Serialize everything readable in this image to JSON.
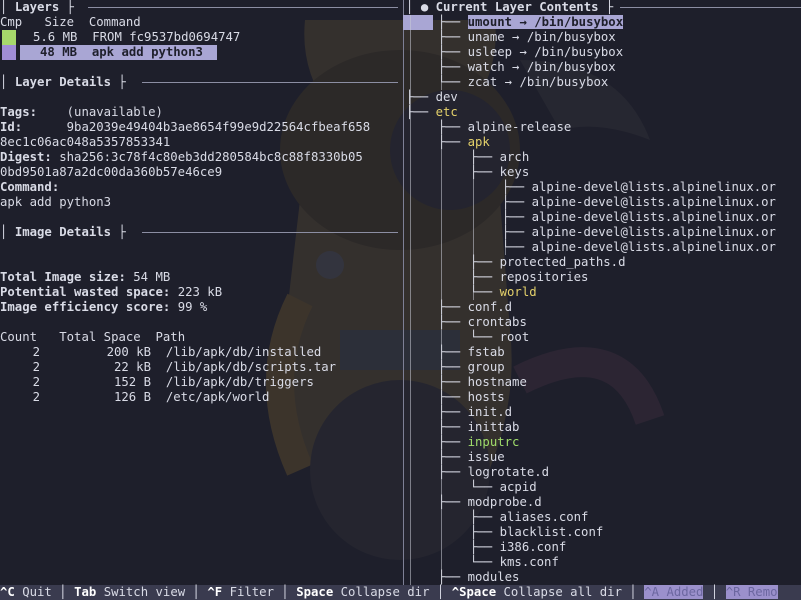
{
  "panes": {
    "layers": {
      "title": "Layers",
      "columns": [
        "Cmp",
        "Size",
        "Command"
      ],
      "rows": [
        {
          "size": "5.6 MB",
          "command": "FROM fc9537bd0694747",
          "swatch": "#a6d86b",
          "selected": false
        },
        {
          "size": "48 MB",
          "command": "apk add python3",
          "swatch": "#a08dd6",
          "selected": true
        }
      ]
    },
    "layer_details": {
      "title": "Layer Details",
      "tags_label": "Tags:",
      "tags_value": "(unavailable)",
      "id_label": "Id:",
      "id_value_1": "9ba2039e49404b3ae8654f99e9d22564cfbeaf658",
      "id_value_2": "8ec1c06ac048a5357853341",
      "digest_label": "Digest:",
      "digest_value_1": "sha256:3c78f4c80eb3dd280584bc8c88f8330b05",
      "digest_value_2": "0bd9501a87a2dc00da360b57e46ce9",
      "command_label": "Command:",
      "command_value": "apk add python3"
    },
    "image_details": {
      "title": "Image Details",
      "total_size_label": "Total Image size:",
      "total_size_value": "54 MB",
      "wasted_label": "Potential wasted space:",
      "wasted_value": "223 kB",
      "efficiency_label": "Image efficiency score:",
      "efficiency_value": "99 %",
      "table_headers": [
        "Count",
        "Total Space",
        "Path"
      ],
      "rows": [
        {
          "count": "2",
          "space": "200 kB",
          "path": "/lib/apk/db/installed"
        },
        {
          "count": "2",
          "space": "22 kB",
          "path": "/lib/apk/db/scripts.tar"
        },
        {
          "count": "2",
          "space": "152 B",
          "path": "/lib/apk/db/triggers"
        },
        {
          "count": "2",
          "space": "126 B",
          "path": "/etc/apk/world"
        }
      ]
    },
    "contents": {
      "title": "Current Layer Contents",
      "tree": [
        {
          "prefix": "├── ",
          "text": "umount → /bin/busybox",
          "depth": 1,
          "state": "selected"
        },
        {
          "prefix": "├── ",
          "text": "uname → /bin/busybox",
          "depth": 1,
          "state": "normal"
        },
        {
          "prefix": "├── ",
          "text": "usleep → /bin/busybox",
          "depth": 1,
          "state": "normal"
        },
        {
          "prefix": "├── ",
          "text": "watch → /bin/busybox",
          "depth": 1,
          "state": "normal"
        },
        {
          "prefix": "└── ",
          "text": "zcat → /bin/busybox",
          "depth": 1,
          "state": "normal"
        },
        {
          "prefix": "├── ",
          "text": "dev",
          "depth": 0,
          "state": "normal"
        },
        {
          "prefix": "├── ",
          "text": "etc",
          "depth": 0,
          "state": "modified"
        },
        {
          "prefix": "├── ",
          "text": "alpine-release",
          "depth": 1,
          "state": "normal"
        },
        {
          "prefix": "├── ",
          "text": "apk",
          "depth": 1,
          "state": "modified"
        },
        {
          "prefix": "├── ",
          "text": "arch",
          "depth": 2,
          "state": "normal"
        },
        {
          "prefix": "├── ",
          "text": "keys",
          "depth": 2,
          "state": "normal"
        },
        {
          "prefix": "├── ",
          "text": "alpine-devel@lists.alpinelinux.or",
          "depth": 3,
          "state": "normal"
        },
        {
          "prefix": "├── ",
          "text": "alpine-devel@lists.alpinelinux.or",
          "depth": 3,
          "state": "normal"
        },
        {
          "prefix": "├── ",
          "text": "alpine-devel@lists.alpinelinux.or",
          "depth": 3,
          "state": "normal"
        },
        {
          "prefix": "├── ",
          "text": "alpine-devel@lists.alpinelinux.or",
          "depth": 3,
          "state": "normal"
        },
        {
          "prefix": "└── ",
          "text": "alpine-devel@lists.alpinelinux.or",
          "depth": 3,
          "state": "normal"
        },
        {
          "prefix": "├── ",
          "text": "protected_paths.d",
          "depth": 2,
          "state": "normal"
        },
        {
          "prefix": "├── ",
          "text": "repositories",
          "depth": 2,
          "state": "normal"
        },
        {
          "prefix": "└── ",
          "text": "world",
          "depth": 2,
          "state": "modified"
        },
        {
          "prefix": "├── ",
          "text": "conf.d",
          "depth": 1,
          "state": "normal"
        },
        {
          "prefix": "├── ",
          "text": "crontabs",
          "depth": 1,
          "state": "normal"
        },
        {
          "prefix": "└── ",
          "text": "root",
          "depth": 2,
          "state": "normal"
        },
        {
          "prefix": "├── ",
          "text": "fstab",
          "depth": 1,
          "state": "normal"
        },
        {
          "prefix": "├── ",
          "text": "group",
          "depth": 1,
          "state": "normal"
        },
        {
          "prefix": "├── ",
          "text": "hostname",
          "depth": 1,
          "state": "normal"
        },
        {
          "prefix": "├── ",
          "text": "hosts",
          "depth": 1,
          "state": "normal"
        },
        {
          "prefix": "├── ",
          "text": "init.d",
          "depth": 1,
          "state": "normal"
        },
        {
          "prefix": "├── ",
          "text": "inittab",
          "depth": 1,
          "state": "normal"
        },
        {
          "prefix": "├── ",
          "text": "inputrc",
          "depth": 1,
          "state": "added"
        },
        {
          "prefix": "├── ",
          "text": "issue",
          "depth": 1,
          "state": "normal"
        },
        {
          "prefix": "├── ",
          "text": "logrotate.d",
          "depth": 1,
          "state": "normal"
        },
        {
          "prefix": "└── ",
          "text": "acpid",
          "depth": 2,
          "state": "normal"
        },
        {
          "prefix": "├── ",
          "text": "modprobe.d",
          "depth": 1,
          "state": "normal"
        },
        {
          "prefix": "├── ",
          "text": "aliases.conf",
          "depth": 2,
          "state": "normal"
        },
        {
          "prefix": "├── ",
          "text": "blacklist.conf",
          "depth": 2,
          "state": "normal"
        },
        {
          "prefix": "├── ",
          "text": "i386.conf",
          "depth": 2,
          "state": "normal"
        },
        {
          "prefix": "└── ",
          "text": "kms.conf",
          "depth": 2,
          "state": "normal"
        },
        {
          "prefix": "├── ",
          "text": "modules",
          "depth": 1,
          "state": "normal"
        }
      ]
    }
  },
  "statusbar": [
    {
      "key": "^C",
      "label": "Quit"
    },
    {
      "key": "Tab",
      "label": "Switch view"
    },
    {
      "key": "^F",
      "label": "Filter"
    },
    {
      "key": "Space",
      "label": "Collapse dir"
    },
    {
      "key": "^Space",
      "label": "Collapse all dir"
    },
    {
      "key": "^A",
      "label": "Added",
      "pill": true
    },
    {
      "key": "^R",
      "label": "Remo",
      "pill": true
    }
  ],
  "colors": {
    "background": "#1e1f2b",
    "modified": "#e3d06a",
    "added": "#9fdc6b",
    "selection": "#a9a6d4"
  },
  "icons": {
    "collapse_marker": "●"
  }
}
